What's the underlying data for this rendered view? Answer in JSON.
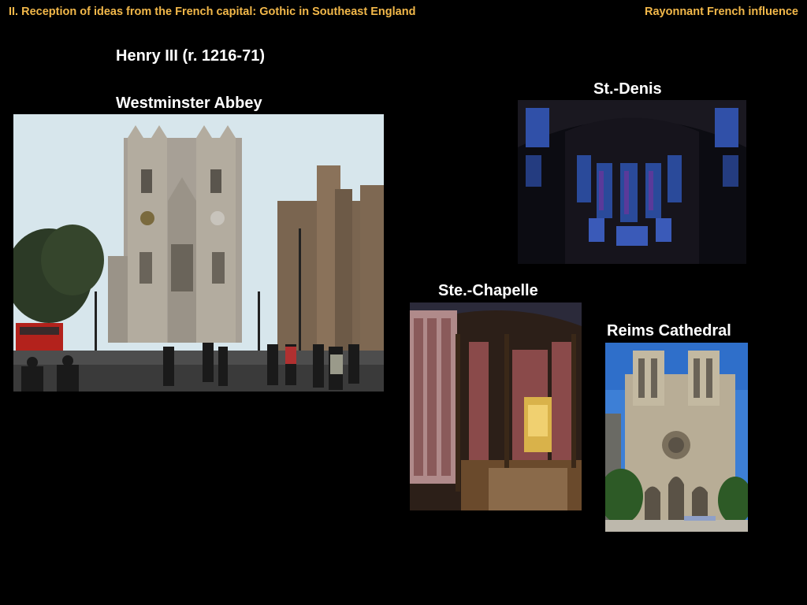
{
  "header": {
    "section_title": "II. Reception of ideas from the French capital: Gothic in Southeast England",
    "topic": "Rayonnant French influence"
  },
  "main": {
    "subtitle": "Henry III (r. 1216-71)",
    "westminster_label": "Westminster Abbey",
    "st_denis_label": "St.-Denis",
    "ste_chapelle_label": "Ste.-Chapelle",
    "reims_label": "Reims Cathedral"
  },
  "colors": {
    "background": "#000000",
    "header_text": "#f2b84a",
    "label_text": "#ffffff"
  }
}
